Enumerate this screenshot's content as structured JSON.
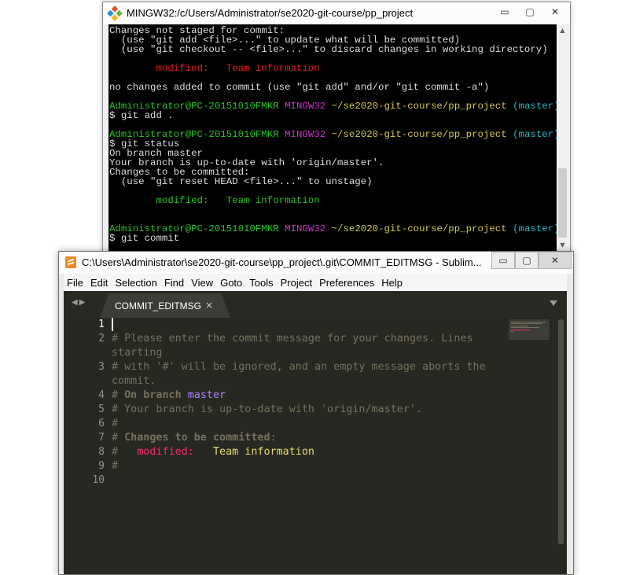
{
  "terminal": {
    "title": "MINGW32:/c/Users/Administrator/se2020-git-course/pp_project",
    "buttons": {
      "minimize": "▭",
      "maximize": "▢",
      "close": "✕"
    },
    "scroll_up": "▲",
    "scroll_down": "▼",
    "lines": [
      "Changes not staged for commit:",
      "  (use \"git add <file>...\" to update what will be committed)",
      "  (use \"git checkout -- <file>...\" to discard changes in working directory)",
      "",
      "        modified:   Team information",
      "",
      "no changes added to commit (use \"git add\" and/or \"git commit -a\")",
      "",
      "Administrator@PC-20151010FMKR MINGW32 ~/se2020-git-course/pp_project (master)",
      "$ git add .",
      "",
      "Administrator@PC-20151010FMKR MINGW32 ~/se2020-git-course/pp_project (master)",
      "$ git status",
      "On branch master",
      "Your branch is up-to-date with 'origin/master'.",
      "Changes to be committed:",
      "  (use \"git reset HEAD <file>...\" to unstage)",
      "",
      "        modified:   Team information",
      "",
      "",
      "Administrator@PC-20151010FMKR MINGW32 ~/se2020-git-course/pp_project (master)",
      "$ git commit"
    ]
  },
  "sublime": {
    "title": "C:\\Users\\Administrator\\se2020-git-course\\pp_project\\.git\\COMMIT_EDITMSG - Sublim...",
    "buttons": {
      "minimize": "▭",
      "maximize": "▢",
      "close": "✕"
    },
    "menu": [
      "File",
      "Edit",
      "Selection",
      "Find",
      "View",
      "Goto",
      "Tools",
      "Project",
      "Preferences",
      "Help"
    ],
    "tab_arrows": "◀▶",
    "tab": {
      "label": "COMMIT_EDITMSG",
      "close": "×"
    },
    "line_numbers": [
      "1",
      "2",
      "",
      "3",
      "",
      "4",
      "5",
      "6",
      "7",
      "8",
      "9",
      "10"
    ],
    "code": {
      "l2": "# Please enter the commit message for your changes. Lines",
      "l2b": "starting",
      "l3": "# with '#' will be ignored, and an empty message aborts the",
      "l3b": "commit.",
      "l4_hash": "# ",
      "l4_on": "On branch",
      "l4_branch": "master",
      "l5": "# Your branch is up-to-date with 'origin/master'.",
      "l6": "#",
      "l7_hash": "# ",
      "l7_text": "Changes to be committed",
      "l7_colon": ":",
      "l8_hash": "#   ",
      "l8_mod": "modified:",
      "l8_file": "Team information",
      "l9": "#"
    }
  },
  "colors": {
    "terminal_bg": "#000000",
    "sublime_bg": "#272822",
    "comment": "#75715e",
    "keyword_pink": "#f92672",
    "string_yellow": "#e6db74",
    "purple": "#ae81ff",
    "git_green": "#2bc32b",
    "git_red": "#e02020",
    "git_magenta": "#c838c8",
    "git_cyan": "#23b8c4"
  }
}
